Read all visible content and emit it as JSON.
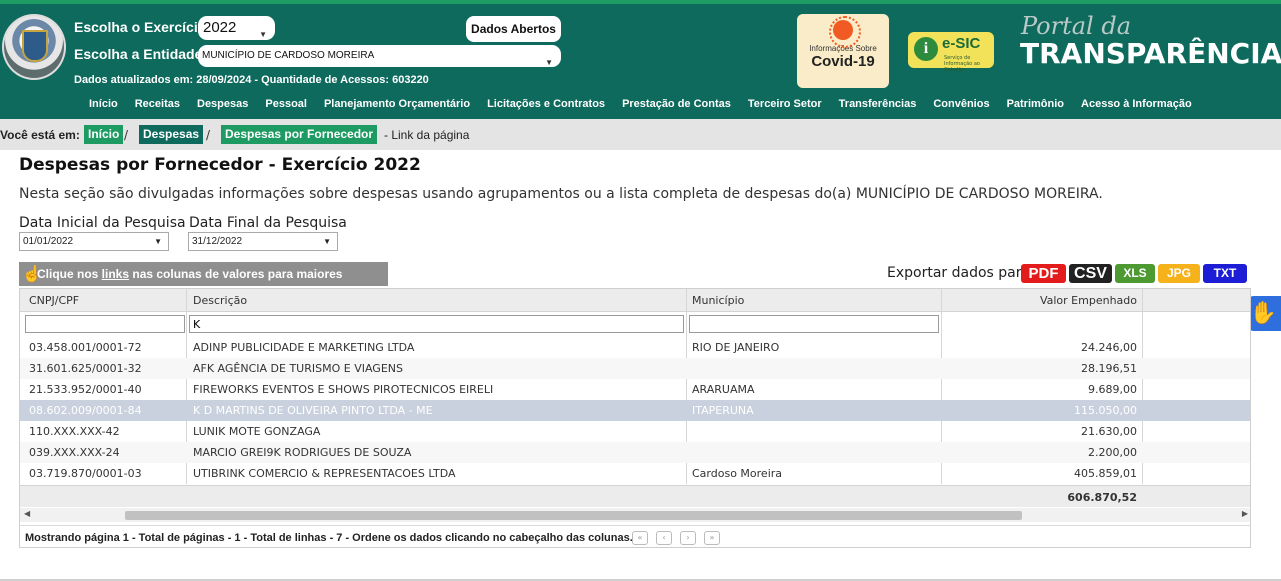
{
  "header": {
    "exercicio_label": "Escolha o Exercício:",
    "exercicio_value": "2022",
    "entidade_label": "Escolha a Entidade:",
    "entidade_value": "MUNICÍPIO DE CARDOSO MOREIRA",
    "dados_abertos": "Dados Abertos",
    "updated_text": "Dados atualizados em: 28/09/2024 - Quantidade de Acessos: 603220",
    "covid_small": "Informações Sobre",
    "covid_big": "Covid-19",
    "esic_title": "e-SIC",
    "esic_sub": "Serviço de Informação ao Cidadão",
    "portal_line1": "Portal da",
    "portal_line2": "TRANSPARÊNCIA"
  },
  "nav": [
    "Início",
    "Receitas",
    "Despesas",
    "Pessoal",
    "Planejamento Orçamentário",
    "Licitações e Contratos",
    "Prestação de Contas",
    "Terceiro Setor",
    "Transferências",
    "Convênios",
    "Patrimônio",
    "Acesso à Informação"
  ],
  "breadcrumb": {
    "you_are": "Você está em:",
    "items": [
      "Início",
      "Despesas",
      "Despesas por Fornecedor"
    ],
    "link_text": "- Link da página"
  },
  "page": {
    "title": "Despesas por Fornecedor - Exercício 2022",
    "description": "Nesta seção são divulgadas informações sobre despesas usando agrupamentos ou a lista completa de despesas do(a) MUNICÍPIO DE CARDOSO MOREIRA.",
    "date_start_label": "Data Inicial da Pesquisa",
    "date_start_value": "01/01/2022",
    "date_end_label": "Data Final da Pesquisa",
    "date_end_value": "31/12/2022",
    "hint_pre": "Clique nos ",
    "hint_link": "links",
    "hint_post": " nas colunas de valores para maiores informações",
    "export_label": "Exportar dados para:",
    "export_buttons": [
      {
        "label": "PDF",
        "color": "#e31b1b"
      },
      {
        "label": "CSV",
        "color": "#222222"
      },
      {
        "label": "XLS",
        "color": "#4e9a32"
      },
      {
        "label": "JPG",
        "color": "#f6b21b"
      },
      {
        "label": "TXT",
        "color": "#1d1dd6"
      }
    ]
  },
  "table": {
    "columns": [
      "CNPJ/CPF",
      "Descrição",
      "Município",
      "Valor Empenhado"
    ],
    "filters": [
      "",
      "K",
      "",
      ""
    ],
    "rows": [
      {
        "cnpj": "03.458.001/0001-72",
        "desc": "ADINP PUBLICIDADE E MARKETING LTDA",
        "mun": "RIO DE JANEIRO",
        "valor": "24.246,00",
        "selected": false
      },
      {
        "cnpj": "31.601.625/0001-32",
        "desc": "AFK AGÊNCIA DE TURISMO E VIAGENS",
        "mun": "",
        "valor": "28.196,51",
        "selected": false
      },
      {
        "cnpj": "21.533.952/0001-40",
        "desc": "FIREWORKS EVENTOS E SHOWS PIROTECNICOS EIRELI",
        "mun": "ARARUAMA",
        "valor": "9.689,00",
        "selected": false
      },
      {
        "cnpj": "08.602.009/0001-84",
        "desc": "K D MARTINS DE OLIVEIRA PINTO LTDA - ME",
        "mun": "ITAPERUNA",
        "valor": "115.050,00",
        "selected": true
      },
      {
        "cnpj": "110.XXX.XXX-42",
        "desc": "LUNIK MOTE GONZAGA",
        "mun": "",
        "valor": "21.630,00",
        "selected": false
      },
      {
        "cnpj": "039.XXX.XXX-24",
        "desc": "MARCIO GREI9K RODRIGUES DE SOUZA",
        "mun": "",
        "valor": "2.200,00",
        "selected": false
      },
      {
        "cnpj": "03.719.870/0001-03",
        "desc": "UTIBRINK COMERCIO & REPRESENTACOES LTDA",
        "mun": "Cardoso Moreira",
        "valor": "405.859,01",
        "selected": false
      }
    ],
    "total": "606.870,52",
    "footer_text": "Mostrando página 1 - Total de páginas - 1 - Total de linhas - 7 - Ordene os dados clicando no cabeçalho das colunas.",
    "pager": [
      "«",
      "‹",
      "›",
      "»"
    ]
  }
}
